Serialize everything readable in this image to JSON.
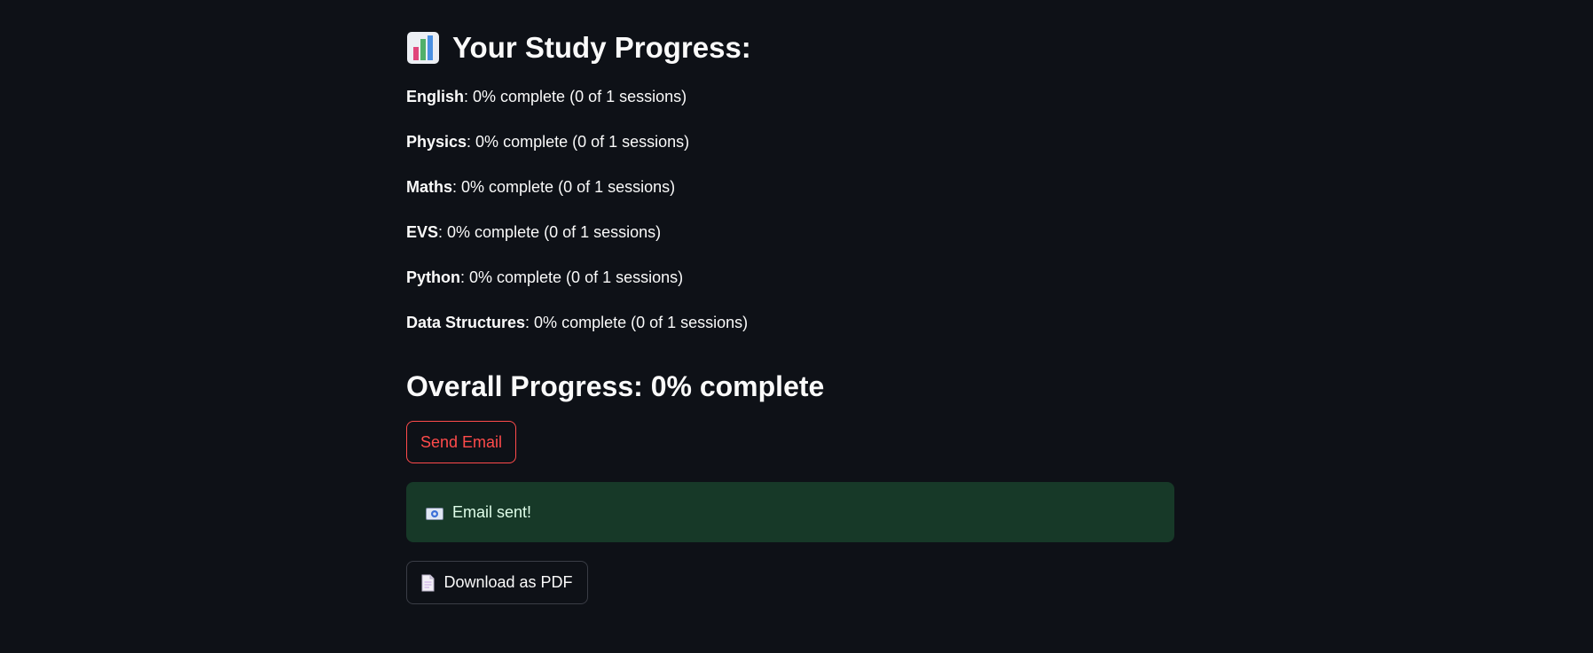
{
  "header": {
    "icon": "bar-chart-icon",
    "title": "Your Study Progress:"
  },
  "subjects": [
    {
      "name": "English",
      "detail": ": 0% complete (0 of 1 sessions)"
    },
    {
      "name": "Physics",
      "detail": ": 0% complete (0 of 1 sessions)"
    },
    {
      "name": "Maths",
      "detail": ": 0% complete (0 of 1 sessions)"
    },
    {
      "name": "EVS",
      "detail": ": 0% complete (0 of 1 sessions)"
    },
    {
      "name": "Python",
      "detail": ": 0% complete (0 of 1 sessions)"
    },
    {
      "name": "Data Structures",
      "detail": ": 0% complete (0 of 1 sessions)"
    }
  ],
  "overall": {
    "text": "Overall Progress: 0% complete"
  },
  "actions": {
    "send_email_label": "Send Email",
    "download_pdf_label": "Download as PDF",
    "download_icon": "document-icon"
  },
  "alert": {
    "icon": "email-icon",
    "message": "Email sent!"
  },
  "colors": {
    "background": "#0e1117",
    "accent": "#ff4b4b",
    "success_bg": "#173928",
    "success_text": "#dffde9"
  }
}
